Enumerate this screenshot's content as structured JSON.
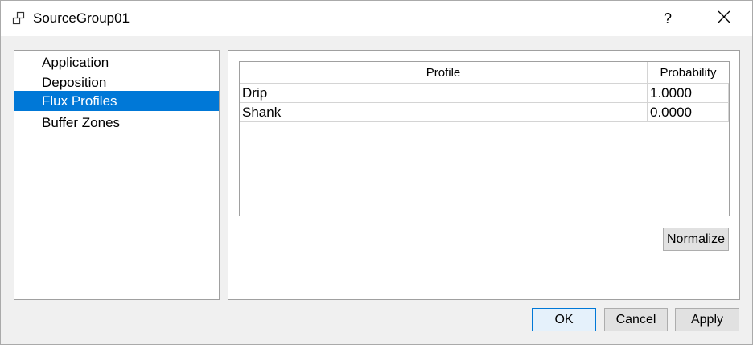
{
  "window": {
    "title": "SourceGroup01",
    "help_label": "?",
    "icons": {
      "app": "window-group-icon",
      "close": "close-icon"
    }
  },
  "sidebar": {
    "items": [
      {
        "label": "Application",
        "selected": false
      },
      {
        "label": "Deposition",
        "selected": false
      },
      {
        "label": "Flux Profiles",
        "selected": true
      },
      {
        "label": "Buffer Zones",
        "selected": false
      }
    ]
  },
  "flux_table": {
    "columns": [
      "Profile",
      "Probability"
    ],
    "rows": [
      [
        "Drip",
        "1.0000"
      ],
      [
        "Shank",
        "0.0000"
      ]
    ]
  },
  "buttons": {
    "normalize": "Normalize",
    "ok": "OK",
    "cancel": "Cancel",
    "apply": "Apply"
  },
  "colors": {
    "selection": "#0078d7",
    "default_button_border": "#0078d7"
  }
}
